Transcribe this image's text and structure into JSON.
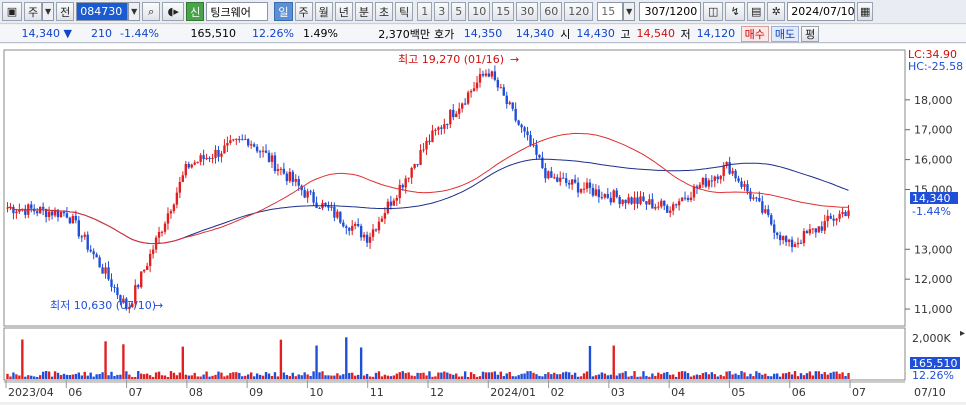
{
  "toolbar": {
    "stock_code": "084730",
    "stock_name": "팅크웨어",
    "mode_ju": "주",
    "mode_jeon": "전",
    "shin_label": "신",
    "il": "일",
    "ju": "주",
    "wol": "월",
    "nyeon": "년",
    "bun": "분",
    "cho": "초",
    "tik": "틱",
    "intervals": [
      "1",
      "3",
      "5",
      "10",
      "15",
      "30",
      "60",
      "120"
    ],
    "interval_value": "15",
    "count": "307/1200",
    "date": "2024/07/10"
  },
  "quote": {
    "price": "14,340",
    "change": "210",
    "change_pct": "-1.44%",
    "volume": "165,510",
    "vol_ratio": "12.26%",
    "turnover": "1.49%",
    "amount": "2,370백만",
    "hoga_label": "호가",
    "bid": "14,350",
    "ask": "14,340",
    "open_label": "시",
    "open": "14,430",
    "high_label": "고",
    "high": "14,540",
    "low_label": "저",
    "low": "14,120",
    "buy_btn": "매수",
    "sell_btn": "매도",
    "eval_btn": "평"
  },
  "chart_data": {
    "type": "candlestick",
    "x_labels": [
      "2023/04",
      "06",
      "07",
      "08",
      "09",
      "10",
      "11",
      "12",
      "2024/01",
      "02",
      "03",
      "04",
      "05",
      "06",
      "07"
    ],
    "y_ticks": [
      "18,000",
      "17,000",
      "16,000",
      "15,000",
      "13,000",
      "12,000",
      "11,000"
    ],
    "ylim": [
      10500,
      19600
    ],
    "price_readout": "14,340",
    "change_readout": "-1.44%",
    "lc_label": "LC:34.90",
    "hc_label": "HC:-25.58",
    "high_annotation": "최고 19,270 (01/16)",
    "low_annotation": "최저 10,630 (07/10)",
    "volume_tick": "2,000K",
    "volume_readout": "165,510",
    "volume_pct": "12.26%",
    "date_readout": "07/10",
    "key_prices": [
      {
        "label": "2023/04",
        "value": 14400
      },
      {
        "label": "06",
        "value": 14200
      },
      {
        "label": "07",
        "value": 11000
      },
      {
        "label": "08",
        "value": 15800
      },
      {
        "label": "09",
        "value": 16700
      },
      {
        "label": "10",
        "value": 14800
      },
      {
        "label": "11",
        "value": 13400
      },
      {
        "label": "12",
        "value": 16600
      },
      {
        "label": "2024/01",
        "value": 19000
      },
      {
        "label": "02",
        "value": 15400
      },
      {
        "label": "03",
        "value": 14800
      },
      {
        "label": "04",
        "value": 14400
      },
      {
        "label": "05",
        "value": 15800
      },
      {
        "label": "06",
        "value": 13100
      },
      {
        "label": "07",
        "value": 14340
      }
    ],
    "colors": {
      "up": "#e02020",
      "down": "#1f4fd8",
      "ma_long": "#1b2e8a",
      "ma_mid": "#e03030"
    }
  }
}
